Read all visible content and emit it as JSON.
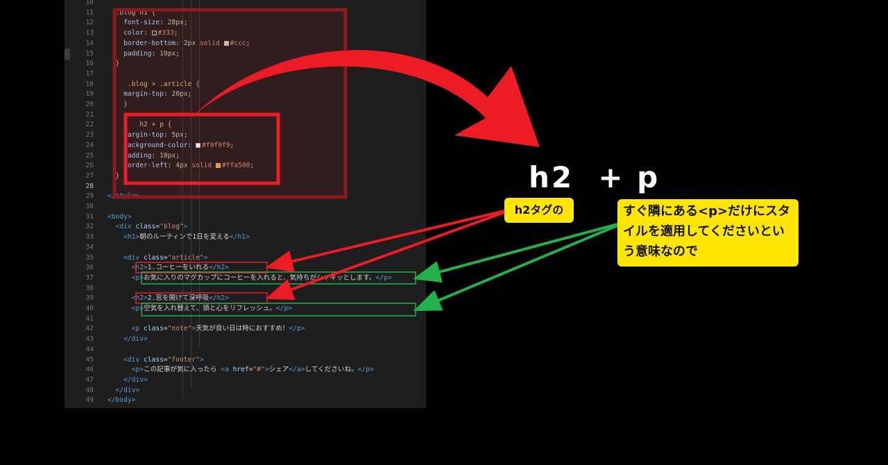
{
  "editor": {
    "lines": [
      {
        "n": "10",
        "segs": []
      },
      {
        "n": "11",
        "segs": [
          {
            "c": "sel",
            "t": "  .blog h1 {"
          }
        ]
      },
      {
        "n": "12",
        "segs": [
          {
            "c": "prop",
            "t": "    font-size"
          },
          {
            "c": "pun",
            "t": ": "
          },
          {
            "c": "num",
            "t": "28px"
          },
          {
            "c": "pun",
            "t": ";"
          }
        ]
      },
      {
        "n": "13",
        "segs": [
          {
            "c": "prop",
            "t": "    color"
          },
          {
            "c": "pun",
            "t": ": "
          },
          {
            "sw": "#333333"
          },
          {
            "c": "val",
            "t": "#333"
          },
          {
            "c": "pun",
            "t": ";"
          }
        ]
      },
      {
        "n": "14",
        "segs": [
          {
            "c": "prop",
            "t": "    border-bottom"
          },
          {
            "c": "pun",
            "t": ": "
          },
          {
            "c": "num",
            "t": "2px"
          },
          {
            "c": "val",
            "t": " solid "
          },
          {
            "sw": "#cccccc"
          },
          {
            "c": "val",
            "t": "#ccc"
          },
          {
            "c": "pun",
            "t": ";"
          }
        ]
      },
      {
        "n": "15",
        "segs": [
          {
            "c": "prop",
            "t": "    padding"
          },
          {
            "c": "pun",
            "t": ": "
          },
          {
            "c": "num",
            "t": "10px"
          },
          {
            "c": "pun",
            "t": ";"
          }
        ]
      },
      {
        "n": "16",
        "segs": [
          {
            "c": "sel",
            "t": "  }"
          }
        ]
      },
      {
        "n": "17",
        "segs": []
      },
      {
        "n": "18",
        "segs": [
          {
            "c": "sel",
            "t": "     .blog > .article {"
          }
        ]
      },
      {
        "n": "19",
        "segs": [
          {
            "c": "prop",
            "t": "    margin-top"
          },
          {
            "c": "pun",
            "t": ": "
          },
          {
            "c": "num",
            "t": "20px"
          },
          {
            "c": "pun",
            "t": ";"
          }
        ]
      },
      {
        "n": "20",
        "segs": [
          {
            "c": "sel",
            "t": "    }"
          }
        ]
      },
      {
        "n": "21",
        "segs": []
      },
      {
        "n": "22",
        "segs": [
          {
            "c": "sel",
            "t": "        h2 + p {"
          }
        ]
      },
      {
        "n": "23",
        "segs": [
          {
            "c": "prop",
            "t": "    margin-top"
          },
          {
            "c": "pun",
            "t": ": "
          },
          {
            "c": "num",
            "t": "5px"
          },
          {
            "c": "pun",
            "t": ";"
          }
        ]
      },
      {
        "n": "24",
        "segs": [
          {
            "c": "prop",
            "t": "    background-color"
          },
          {
            "c": "pun",
            "t": ": "
          },
          {
            "sw": "#f9f9f9"
          },
          {
            "c": "val",
            "t": "#f9f9f9"
          },
          {
            "c": "pun",
            "t": ";"
          }
        ]
      },
      {
        "n": "25",
        "segs": [
          {
            "c": "prop",
            "t": "    padding"
          },
          {
            "c": "pun",
            "t": ": "
          },
          {
            "c": "num",
            "t": "10px"
          },
          {
            "c": "pun",
            "t": ";"
          }
        ]
      },
      {
        "n": "26",
        "segs": [
          {
            "c": "prop",
            "t": "    border-left"
          },
          {
            "c": "pun",
            "t": ": "
          },
          {
            "c": "num",
            "t": "4px"
          },
          {
            "c": "val",
            "t": " solid "
          },
          {
            "sw": "#ffa500"
          },
          {
            "c": "val",
            "t": "#ffa500"
          },
          {
            "c": "pun",
            "t": ";"
          }
        ]
      },
      {
        "n": "27",
        "segs": [
          {
            "c": "sel",
            "t": "  }"
          }
        ]
      },
      {
        "n": "28",
        "cur": true,
        "segs": []
      },
      {
        "n": "29",
        "segs": [
          {
            "c": "tag",
            "t": "</style>"
          }
        ]
      },
      {
        "n": "30",
        "segs": []
      },
      {
        "n": "31",
        "segs": [
          {
            "c": "tag",
            "t": "<body>"
          }
        ]
      },
      {
        "n": "32",
        "segs": [
          {
            "c": "tag",
            "t": "  <div "
          },
          {
            "c": "attr",
            "t": "class"
          },
          {
            "c": "pun",
            "t": "="
          },
          {
            "c": "str",
            "t": "\"blog\""
          },
          {
            "c": "tag",
            "t": ">"
          }
        ]
      },
      {
        "n": "33",
        "segs": [
          {
            "c": "tag",
            "t": "    <h1>"
          },
          {
            "c": "txt",
            "t": "朝のルーティンで1日を変える"
          },
          {
            "c": "tag",
            "t": "</h1>"
          }
        ]
      },
      {
        "n": "34",
        "segs": []
      },
      {
        "n": "35",
        "segs": [
          {
            "c": "tag",
            "t": "    <div "
          },
          {
            "c": "attr",
            "t": "class"
          },
          {
            "c": "pun",
            "t": "="
          },
          {
            "c": "str",
            "t": "\"article\""
          },
          {
            "c": "tag",
            "t": ">"
          }
        ]
      },
      {
        "n": "36",
        "segs": [
          {
            "c": "tag",
            "t": "      <h2>"
          },
          {
            "c": "txt",
            "t": "1.コーヒーをいれる"
          },
          {
            "c": "tag",
            "t": "</h2>"
          }
        ]
      },
      {
        "n": "37",
        "segs": [
          {
            "c": "tag",
            "t": "      <p>"
          },
          {
            "c": "txt",
            "t": "お気に入りのマグカップにコーヒーを入れると、気持ちがシャキッとします。"
          },
          {
            "c": "tag",
            "t": "</p>"
          }
        ]
      },
      {
        "n": "38",
        "segs": []
      },
      {
        "n": "39",
        "segs": [
          {
            "c": "tag",
            "t": "      <h2>"
          },
          {
            "c": "txt",
            "t": "2.窓を開けて深呼吸"
          },
          {
            "c": "tag",
            "t": "</h2>"
          }
        ]
      },
      {
        "n": "40",
        "segs": [
          {
            "c": "tag",
            "t": "      <p>"
          },
          {
            "c": "txt",
            "t": "空気を入れ替えて、頭と心をリフレッシュ。"
          },
          {
            "c": "tag",
            "t": "</p>"
          }
        ]
      },
      {
        "n": "41",
        "segs": []
      },
      {
        "n": "42",
        "segs": [
          {
            "c": "tag",
            "t": "      <p "
          },
          {
            "c": "attr",
            "t": "class"
          },
          {
            "c": "pun",
            "t": "="
          },
          {
            "c": "str",
            "t": "\"note\""
          },
          {
            "c": "tag",
            "t": ">"
          },
          {
            "c": "txt",
            "t": "天気が良い日は特におすすめ！"
          },
          {
            "c": "tag",
            "t": "</p>"
          }
        ]
      },
      {
        "n": "43",
        "segs": [
          {
            "c": "tag",
            "t": "    </div>"
          }
        ]
      },
      {
        "n": "44",
        "segs": []
      },
      {
        "n": "45",
        "segs": [
          {
            "c": "tag",
            "t": "    <div "
          },
          {
            "c": "attr",
            "t": "class"
          },
          {
            "c": "pun",
            "t": "="
          },
          {
            "c": "str",
            "t": "\"footer\""
          },
          {
            "c": "tag",
            "t": ">"
          }
        ]
      },
      {
        "n": "46",
        "segs": [
          {
            "c": "tag",
            "t": "      <p>"
          },
          {
            "c": "txt",
            "t": "この記事が気に入ったら "
          },
          {
            "c": "tag",
            "t": "<a "
          },
          {
            "c": "attr",
            "t": "href"
          },
          {
            "c": "pun",
            "t": "="
          },
          {
            "c": "str",
            "t": "\"#\""
          },
          {
            "c": "tag",
            "t": ">"
          },
          {
            "c": "txt",
            "t": "シェア"
          },
          {
            "c": "tag",
            "t": "</a>"
          },
          {
            "c": "txt",
            "t": "してくださいね。"
          },
          {
            "c": "tag",
            "t": "</p>"
          }
        ]
      },
      {
        "n": "47",
        "segs": [
          {
            "c": "tag",
            "t": "    </div>"
          }
        ]
      },
      {
        "n": "48",
        "segs": [
          {
            "c": "tag",
            "t": "  </div>"
          }
        ]
      },
      {
        "n": "49",
        "segs": [
          {
            "c": "tag",
            "t": "</body>"
          }
        ]
      }
    ]
  },
  "annotation": {
    "selector_label": "h2  + p",
    "callout_h2": "h2タグの",
    "callout_p": "すぐ隣にある<p>だけにスタイルを適用してくださいという意味なので"
  },
  "colors": {
    "red": "#ed1c24",
    "green": "#22b24c",
    "yellow": "#ffe600",
    "editor_bg": "#1e1e1e"
  }
}
